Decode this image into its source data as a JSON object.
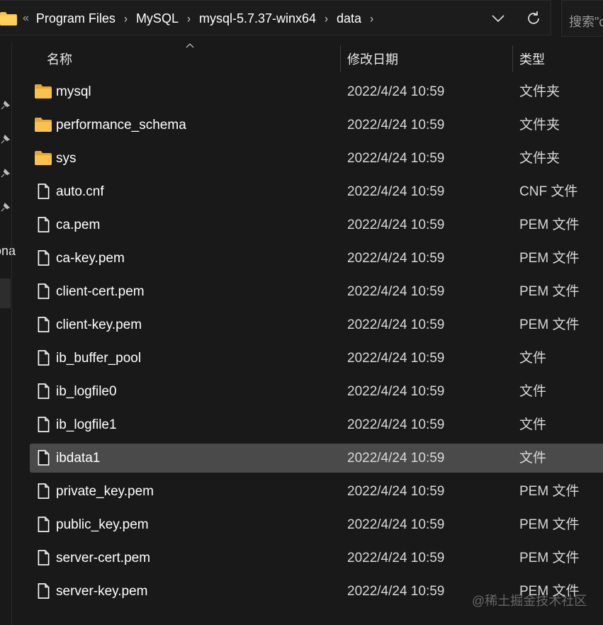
{
  "address_bar": {
    "overflow_glyph": "«",
    "crumbs": [
      "Program Files",
      "MySQL",
      "mysql-5.7.37-winx64",
      "data"
    ],
    "separator": "›"
  },
  "search": {
    "placeholder": "搜索\"d"
  },
  "nav_pane_fragment": "ona",
  "columns": {
    "name": "名称",
    "date": "修改日期",
    "type": "类型"
  },
  "files": [
    {
      "name": "mysql",
      "date": "2022/4/24 10:59",
      "type": "文件夹",
      "icon": "folder-icon"
    },
    {
      "name": "performance_schema",
      "date": "2022/4/24 10:59",
      "type": "文件夹",
      "icon": "folder-icon"
    },
    {
      "name": "sys",
      "date": "2022/4/24 10:59",
      "type": "文件夹",
      "icon": "folder-icon"
    },
    {
      "name": "auto.cnf",
      "date": "2022/4/24 10:59",
      "type": "CNF 文件",
      "icon": "file-icon"
    },
    {
      "name": "ca.pem",
      "date": "2022/4/24 10:59",
      "type": "PEM 文件",
      "icon": "file-icon"
    },
    {
      "name": "ca-key.pem",
      "date": "2022/4/24 10:59",
      "type": "PEM 文件",
      "icon": "file-icon"
    },
    {
      "name": "client-cert.pem",
      "date": "2022/4/24 10:59",
      "type": "PEM 文件",
      "icon": "file-icon"
    },
    {
      "name": "client-key.pem",
      "date": "2022/4/24 10:59",
      "type": "PEM 文件",
      "icon": "file-icon"
    },
    {
      "name": "ib_buffer_pool",
      "date": "2022/4/24 10:59",
      "type": "文件",
      "icon": "file-icon"
    },
    {
      "name": "ib_logfile0",
      "date": "2022/4/24 10:59",
      "type": "文件",
      "icon": "file-icon"
    },
    {
      "name": "ib_logfile1",
      "date": "2022/4/24 10:59",
      "type": "文件",
      "icon": "file-icon"
    },
    {
      "name": "ibdata1",
      "date": "2022/4/24 10:59",
      "type": "文件",
      "icon": "file-icon",
      "selected": true
    },
    {
      "name": "private_key.pem",
      "date": "2022/4/24 10:59",
      "type": "PEM 文件",
      "icon": "file-icon"
    },
    {
      "name": "public_key.pem",
      "date": "2022/4/24 10:59",
      "type": "PEM 文件",
      "icon": "file-icon"
    },
    {
      "name": "server-cert.pem",
      "date": "2022/4/24 10:59",
      "type": "PEM 文件",
      "icon": "file-icon"
    },
    {
      "name": "server-key.pem",
      "date": "2022/4/24 10:59",
      "type": "PEM 文件",
      "icon": "file-icon"
    }
  ],
  "watermark": "@稀土掘金技术社区",
  "colors": {
    "background": "#191919",
    "selected_row": "#4a4a4a",
    "folder": "#f8c24d",
    "text": "#ffffff"
  }
}
